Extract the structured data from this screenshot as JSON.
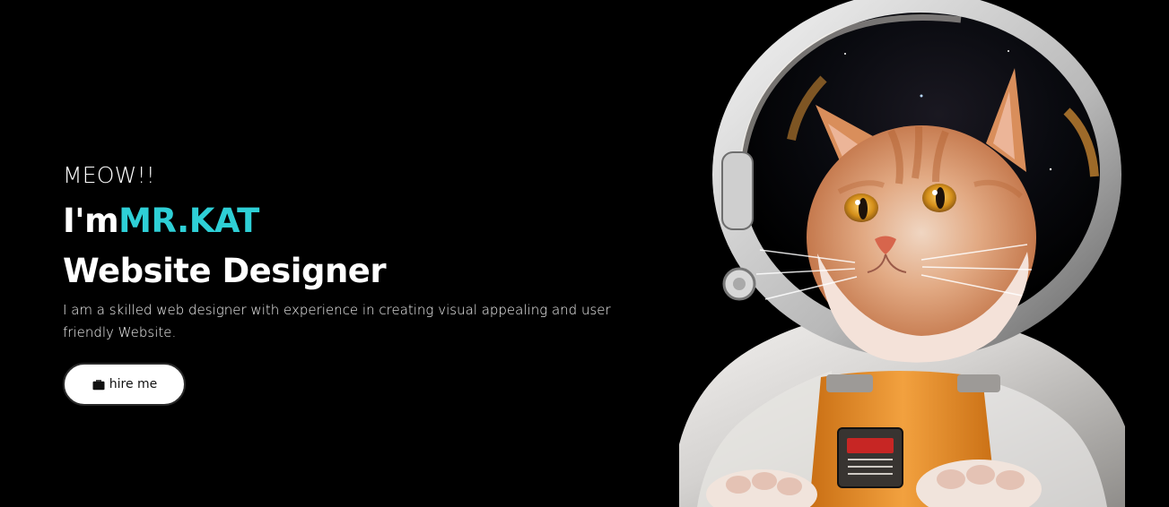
{
  "hero": {
    "greeting": "MEOW!!",
    "intro_prefix": "I'm",
    "name": "MR.KAT",
    "role": "Website Designer",
    "description": "I am a skilled web designer with experience in creating visual appealing and user friendly Website.",
    "hire_button": {
      "icon": "briefcase-icon",
      "label": "hire me"
    }
  },
  "image": {
    "subject": "astronaut-cat-illustration"
  },
  "colors": {
    "background": "#000000",
    "text": "#ffffff",
    "accent": "#2ecfd6",
    "button_bg": "#ffffff",
    "button_text": "#111111"
  }
}
